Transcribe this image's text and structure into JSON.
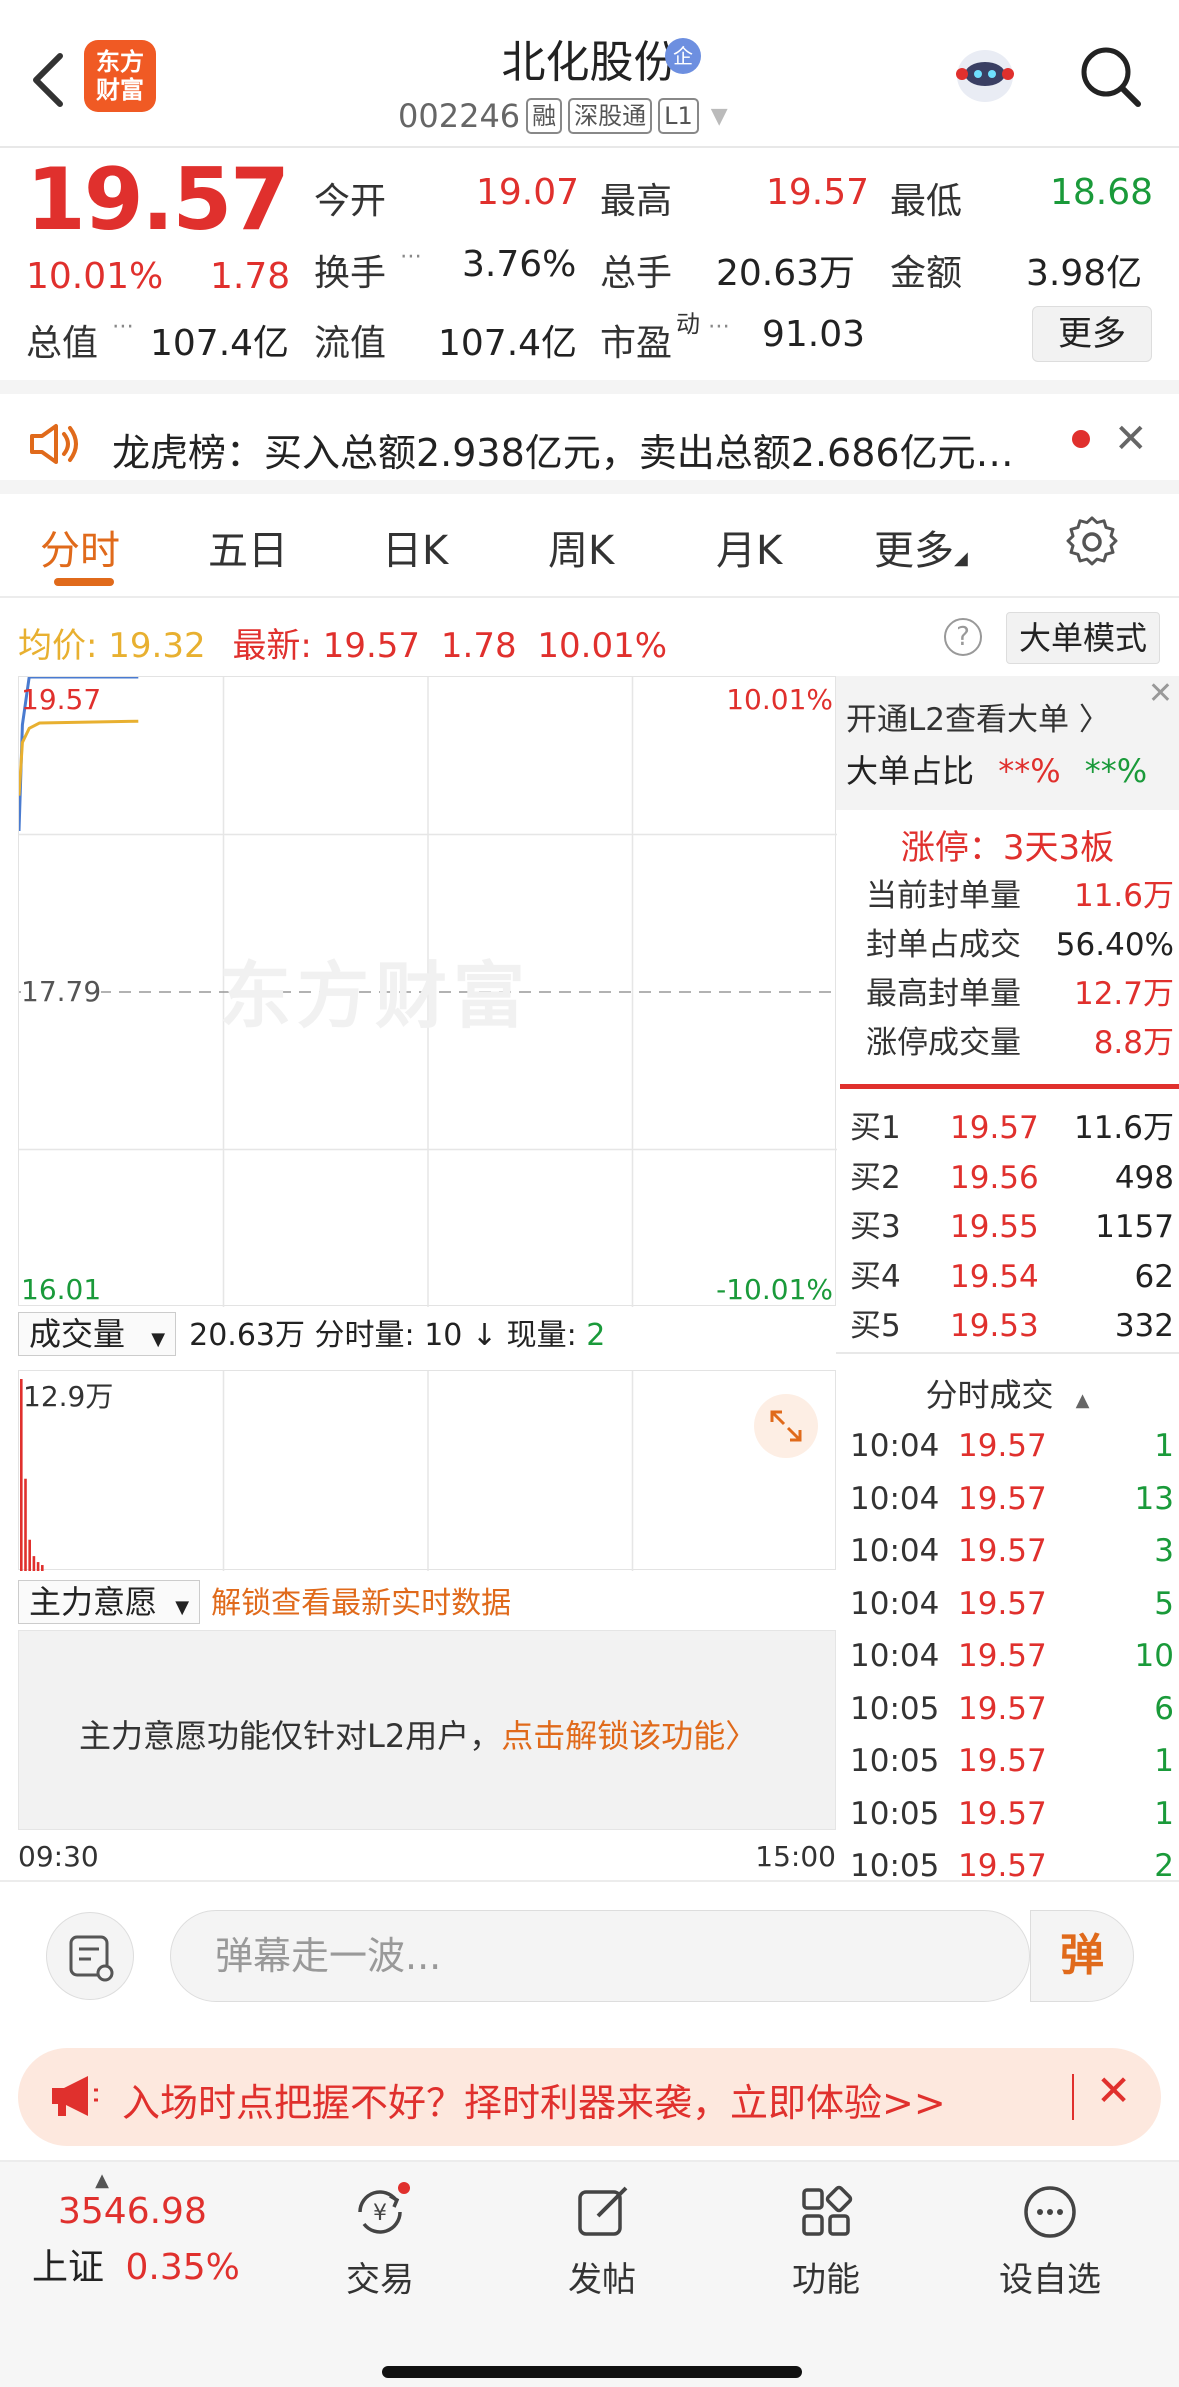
{
  "header": {
    "logo_text": "东方财富",
    "stock_name": "北化股份",
    "ent_badge": "企",
    "code": "002246",
    "tags": [
      "融",
      "深股通",
      "L1"
    ]
  },
  "quote": {
    "price": "19.57",
    "change_pct": "10.01%",
    "change_amt": "1.78",
    "fields": {
      "open_label": "今开",
      "open": "19.07",
      "high_label": "最高",
      "high": "19.57",
      "low_label": "最低",
      "low": "18.68",
      "turnover_label": "换手",
      "turnover": "3.76%",
      "volume_label": "总手",
      "volume": "20.63万",
      "amount_label": "金额",
      "amount": "3.98亿",
      "mcap_label": "总值",
      "mcap": "107.4亿",
      "float_label": "流值",
      "float": "107.4亿",
      "pe_label": "市盈",
      "pe_sup": "动",
      "pe": "91.03"
    },
    "more_button": "更多"
  },
  "banner": {
    "text": "龙虎榜：买入总额2.938亿元，卖出总额2.686亿元…"
  },
  "tabs": [
    "分时",
    "五日",
    "日K",
    "周K",
    "月K",
    "更多"
  ],
  "info_row": {
    "avg_label": "均价:",
    "avg": "19.32",
    "latest_label": "最新:",
    "latest": "19.57",
    "chg": "1.78",
    "pct": "10.01%",
    "help": "?",
    "mode_button": "大单模式"
  },
  "chart_data": {
    "type": "line",
    "title": "",
    "price_max": "19.57",
    "price_mid": "17.79",
    "price_min": "16.01",
    "pct_max": "10.01%",
    "pct_min": "-10.01%",
    "ylim": [
      16.01,
      19.57
    ],
    "x_start": "09:30",
    "x_end": "15:00",
    "watermark": "东方财富",
    "series": [
      {
        "name": "最新",
        "color": "#4a7bd0",
        "x": [
          "09:30",
          "09:31",
          "09:33",
          "09:36",
          "10:05"
        ],
        "values": [
          18.7,
          19.3,
          19.57,
          19.57,
          19.57
        ]
      },
      {
        "name": "均价",
        "color": "#e8b030",
        "x": [
          "09:30",
          "09:31",
          "09:33",
          "09:36",
          "10:05"
        ],
        "values": [
          18.9,
          19.2,
          19.28,
          19.31,
          19.32
        ]
      }
    ]
  },
  "volume": {
    "select_label": "成交量",
    "summary_total": "20.63万",
    "summary_rest": " 分时量: 10 ↓ 现量: ",
    "summary_now": "2",
    "max_label": "12.9万",
    "bars": [
      12.9,
      6.2,
      2.1,
      1.0,
      0.6,
      0.4
    ]
  },
  "main_force": {
    "select_label": "主力意愿",
    "unlock_link": "解锁查看最新实时数据",
    "notice": "主力意愿功能仅针对L2用户，",
    "notice_link": "点击解锁该功能〉"
  },
  "right_panel": {
    "l2_link": "开通L2查看大单 〉",
    "big_ratio_label": "大单占比",
    "big_buy": "**%",
    "big_sell": "**%",
    "limit_title": "涨停：3天3板",
    "limit_rows": [
      {
        "label": "当前封单量",
        "value": "11.6万",
        "red": true
      },
      {
        "label": "封单占成交",
        "value": "56.40%",
        "red": false
      },
      {
        "label": "最高封单量",
        "value": "12.7万",
        "red": true
      },
      {
        "label": "涨停成交量",
        "value": "8.8万",
        "red": true
      }
    ],
    "bids": [
      {
        "label": "买1",
        "price": "19.57",
        "qty": "11.6万"
      },
      {
        "label": "买2",
        "price": "19.56",
        "qty": "498"
      },
      {
        "label": "买3",
        "price": "19.55",
        "qty": "1157"
      },
      {
        "label": "买4",
        "price": "19.54",
        "qty": "62"
      },
      {
        "label": "买5",
        "price": "19.53",
        "qty": "332"
      }
    ],
    "trades_title": "分时成交",
    "trades": [
      {
        "time": "10:04",
        "price": "19.57",
        "qty": "1"
      },
      {
        "time": "10:04",
        "price": "19.57",
        "qty": "13"
      },
      {
        "time": "10:04",
        "price": "19.57",
        "qty": "3"
      },
      {
        "time": "10:04",
        "price": "19.57",
        "qty": "5"
      },
      {
        "time": "10:04",
        "price": "19.57",
        "qty": "10"
      },
      {
        "time": "10:05",
        "price": "19.57",
        "qty": "6"
      },
      {
        "time": "10:05",
        "price": "19.57",
        "qty": "1"
      },
      {
        "time": "10:05",
        "price": "19.57",
        "qty": "1"
      },
      {
        "time": "10:05",
        "price": "19.57",
        "qty": "2"
      }
    ]
  },
  "comment_bar": {
    "placeholder": "弹幕走一波...",
    "danmu_button": "弹"
  },
  "promo": {
    "text": "入场时点把握不好？择时利器来袭，立即体验>>"
  },
  "bottom_nav": {
    "index_value": "3546.98",
    "index_name": "上证",
    "index_pct": "0.35%",
    "items": [
      "交易",
      "发帖",
      "功能",
      "设自选"
    ]
  },
  "colors": {
    "up": "#e0302d",
    "down": "#1a9a3a",
    "accent": "#e06a1b"
  }
}
